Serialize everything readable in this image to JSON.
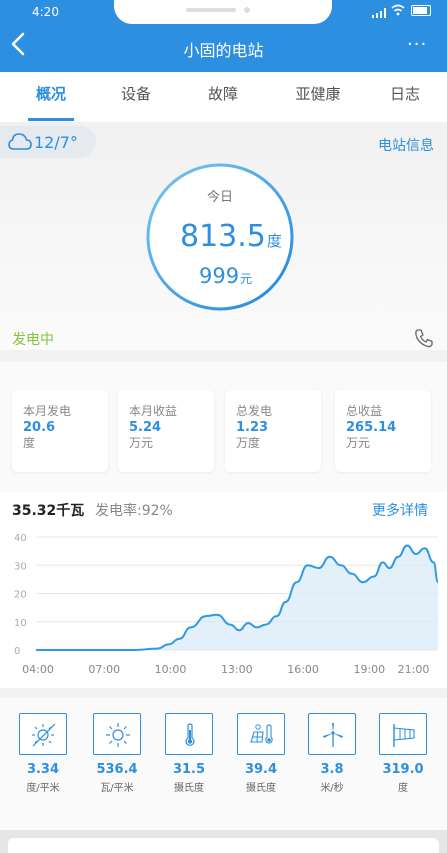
{
  "status_bar": {
    "time": "4:20"
  },
  "header": {
    "title": "小固的电站",
    "more_label": "···"
  },
  "tabs": [
    {
      "label": "概况",
      "active": true
    },
    {
      "label": "设备",
      "active": false
    },
    {
      "label": "故障",
      "active": false
    },
    {
      "label": "亚健康",
      "active": false
    },
    {
      "label": "日志",
      "active": false
    }
  ],
  "overview": {
    "weather": "12/7°",
    "weather_icon": "cloud-icon",
    "station_info_link": "电站信息",
    "today_label": "今日",
    "energy_value": "813.5",
    "energy_unit": "度",
    "money_value": "999",
    "money_unit": "元",
    "status": "发电中",
    "phone_icon": "phone-icon"
  },
  "stats": [
    {
      "label": "本月发电",
      "value": "20.6",
      "unit": "度"
    },
    {
      "label": "本月收益",
      "value": "5.24",
      "unit": "万元"
    },
    {
      "label": "总发电",
      "value": "1.23",
      "unit": "万度"
    },
    {
      "label": "总收益",
      "value": "265.14",
      "unit": "万元"
    }
  ],
  "power": {
    "value": "35.32千瓦",
    "rate": "发电率:92%",
    "more_link": "更多详情"
  },
  "chart_data": {
    "type": "area",
    "x": [
      "04:00",
      "07:00",
      "10:00",
      "13:00",
      "16:00",
      "19:00",
      "21:00"
    ],
    "ylim": [
      0,
      40
    ],
    "yticks": [
      "0",
      "10",
      "20",
      "30",
      "40"
    ],
    "points": [
      [
        4.0,
        0
      ],
      [
        5.5,
        0
      ],
      [
        7.0,
        0
      ],
      [
        8.5,
        0
      ],
      [
        9.5,
        0.5
      ],
      [
        10.0,
        2
      ],
      [
        10.5,
        4
      ],
      [
        11.0,
        8
      ],
      [
        11.7,
        12
      ],
      [
        12.2,
        12.5
      ],
      [
        12.8,
        9
      ],
      [
        13.2,
        7
      ],
      [
        13.6,
        9.5
      ],
      [
        14.0,
        8
      ],
      [
        14.4,
        9
      ],
      [
        14.9,
        12
      ],
      [
        15.3,
        17
      ],
      [
        15.8,
        24
      ],
      [
        16.3,
        30
      ],
      [
        16.8,
        29
      ],
      [
        17.3,
        33
      ],
      [
        17.8,
        30
      ],
      [
        18.3,
        27
      ],
      [
        18.8,
        24
      ],
      [
        19.3,
        26
      ],
      [
        19.7,
        31
      ],
      [
        20.0,
        29
      ],
      [
        20.4,
        33
      ],
      [
        20.8,
        37
      ],
      [
        21.2,
        34
      ],
      [
        21.6,
        36
      ],
      [
        22.0,
        31
      ],
      [
        22.2,
        24
      ]
    ],
    "grid": true,
    "line_color": "#2d9be3",
    "fill_color": "#d9eaf7"
  },
  "sensors": [
    {
      "icon": "sun-day-icon",
      "value": "3.34",
      "unit": "度/平米"
    },
    {
      "icon": "sun-icon",
      "value": "536.4",
      "unit": "瓦/平米"
    },
    {
      "icon": "thermometer-icon",
      "value": "31.5",
      "unit": "摄氏度"
    },
    {
      "icon": "panel-temperature-icon",
      "value": "39.4",
      "unit": "摄氏度"
    },
    {
      "icon": "wind-turbine-icon",
      "value": "3.8",
      "unit": "米/秒"
    },
    {
      "icon": "wind-direction-icon",
      "value": "319.0",
      "unit": "度"
    }
  ],
  "colors": {
    "accent": "#2d8fdf",
    "status": "#7fc63a"
  }
}
